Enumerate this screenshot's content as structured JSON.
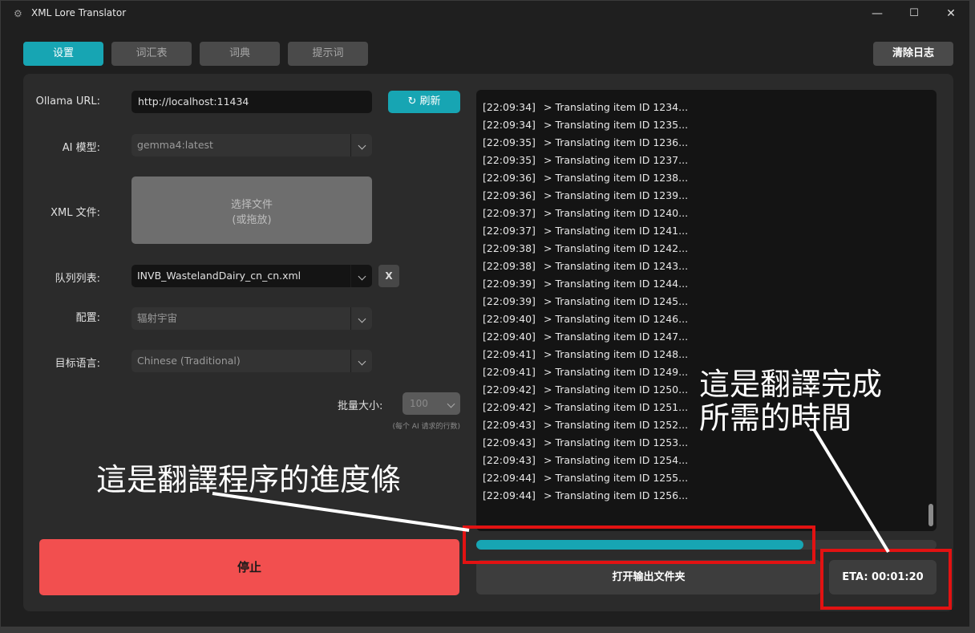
{
  "window": {
    "title": "XML Lore Translator",
    "controls": {
      "minimize": "—",
      "maximize": "☐",
      "close": "✕"
    }
  },
  "tabs": [
    {
      "label": "设置",
      "active": true
    },
    {
      "label": "词汇表",
      "active": false
    },
    {
      "label": "词典",
      "active": false
    },
    {
      "label": "提示词",
      "active": false
    }
  ],
  "clear_log_label": "清除日志",
  "form": {
    "ollama_url_label": "Ollama URL:",
    "ollama_url_value": "http://localhost:11434",
    "refresh_label": "刷新",
    "model_label": "AI 模型:",
    "model_value": "gemma4:latest",
    "xml_label": "XML 文件:",
    "xml_drop_line1": "选择文件",
    "xml_drop_line2": "(或拖放)",
    "queue_label": "队列列表:",
    "queue_value": "INVB_WastelandDairy_cn_cn.xml",
    "queue_clear": "X",
    "profile_label": "配置:",
    "profile_value": "辐射宇宙",
    "target_lang_label": "目标语言:",
    "target_lang_value": "Chinese (Traditional)",
    "batch_label": "批量大小:",
    "batch_value": "100",
    "batch_hint": "(每个 AI 请求的行数)"
  },
  "stop_label": "停止",
  "log_lines": [
    {
      "time": "[22:09:34]",
      "text": "> Translating item ID 1234..."
    },
    {
      "time": "[22:09:34]",
      "text": "> Translating item ID 1235..."
    },
    {
      "time": "[22:09:35]",
      "text": "> Translating item ID 1236..."
    },
    {
      "time": "[22:09:35]",
      "text": "> Translating item ID 1237..."
    },
    {
      "time": "[22:09:36]",
      "text": "> Translating item ID 1238..."
    },
    {
      "time": "[22:09:36]",
      "text": "> Translating item ID 1239..."
    },
    {
      "time": "[22:09:37]",
      "text": "> Translating item ID 1240..."
    },
    {
      "time": "[22:09:37]",
      "text": "> Translating item ID 1241..."
    },
    {
      "time": "[22:09:38]",
      "text": "> Translating item ID 1242..."
    },
    {
      "time": "[22:09:38]",
      "text": "> Translating item ID 1243..."
    },
    {
      "time": "[22:09:39]",
      "text": "> Translating item ID 1244..."
    },
    {
      "time": "[22:09:39]",
      "text": "> Translating item ID 1245..."
    },
    {
      "time": "[22:09:40]",
      "text": "> Translating item ID 1246..."
    },
    {
      "time": "[22:09:40]",
      "text": "> Translating item ID 1247..."
    },
    {
      "time": "[22:09:41]",
      "text": "> Translating item ID 1248..."
    },
    {
      "time": "[22:09:41]",
      "text": "> Translating item ID 1249..."
    },
    {
      "time": "[22:09:42]",
      "text": "> Translating item ID 1250..."
    },
    {
      "time": "[22:09:42]",
      "text": "> Translating item ID 1251..."
    },
    {
      "time": "[22:09:43]",
      "text": "> Translating item ID 1252..."
    },
    {
      "time": "[22:09:43]",
      "text": "> Translating item ID 1253..."
    },
    {
      "time": "[22:09:43]",
      "text": "> Translating item ID 1254..."
    },
    {
      "time": "[22:09:44]",
      "text": "> Translating item ID 1255..."
    },
    {
      "time": "[22:09:44]",
      "text": "> Translating item ID 1256..."
    }
  ],
  "progress": {
    "fraction": 0.71
  },
  "open_output_label": "打开输出文件夹",
  "eta_label": "ETA: 00:01:20",
  "annotations": {
    "progress_note": "這是翻譯程序的進度條",
    "eta_note_line1": "這是翻譯完成",
    "eta_note_line2": "所需的時間"
  },
  "colors": {
    "accent": "#17a5b3",
    "stop": "#f24f4f",
    "annotation_box": "#e21212"
  }
}
